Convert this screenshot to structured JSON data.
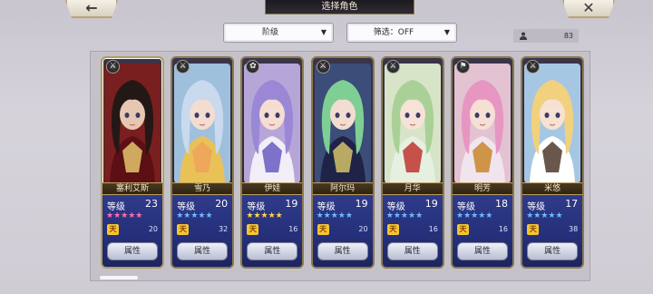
{
  "header": {
    "title": "选择角色",
    "back_icon": "←",
    "close_icon": "✕"
  },
  "filters": {
    "grade": {
      "label": "阶级",
      "arrow": "▼"
    },
    "filter": {
      "label": "筛选：OFF",
      "arrow": "▼"
    }
  },
  "roster_count": "83",
  "attr_label": "属性",
  "level_label": "等级",
  "characters": [
    {
      "name": "塞利艾斯",
      "level": "23",
      "stars_color": "#ff6fa8",
      "elem": "⚔",
      "sub_icon": "天",
      "sub_value": "20",
      "palette": {
        "bg": "#7a1f1f",
        "hair": "#241817",
        "skin": "#e7c7b1",
        "cloth": "#5c0f14",
        "accent": "#e3c56b"
      }
    },
    {
      "name": "雪乃",
      "level": "20",
      "stars_color": "#6fb8ff",
      "elem": "⚔",
      "sub_icon": "天",
      "sub_value": "32",
      "palette": {
        "bg": "#9fc0dc",
        "hair": "#c9d9ee",
        "skin": "#f3dcd0",
        "cloth": "#e8c256",
        "accent": "#f0a25a"
      }
    },
    {
      "name": "伊娃",
      "level": "19",
      "stars_color": "#ffd34a",
      "elem": "✿",
      "sub_icon": "天",
      "sub_value": "16",
      "palette": {
        "bg": "#b6a6d8",
        "hair": "#9a88d6",
        "skin": "#f5ddd2",
        "cloth": "#f1eef8",
        "accent": "#6a5ac2"
      }
    },
    {
      "name": "阿尔玛",
      "level": "19",
      "stars_color": "#6fb8ff",
      "elem": "⚔",
      "sub_icon": "天",
      "sub_value": "20",
      "palette": {
        "bg": "#3b4d78",
        "hair": "#7fcf94",
        "skin": "#f3dcd0",
        "cloth": "#1e2347",
        "accent": "#d3c26a"
      }
    },
    {
      "name": "月华",
      "level": "19",
      "stars_color": "#6fb8ff",
      "elem": "⚔",
      "sub_icon": "天",
      "sub_value": "16",
      "palette": {
        "bg": "#d7e4c8",
        "hair": "#a9d197",
        "skin": "#f6e2d6",
        "cloth": "#e6f0e0",
        "accent": "#c0342f"
      }
    },
    {
      "name": "明芳",
      "level": "18",
      "stars_color": "#6fb8ff",
      "elem": "⚑",
      "sub_icon": "天",
      "sub_value": "16",
      "palette": {
        "bg": "#e3c2d2",
        "hair": "#e796c2",
        "skin": "#f6dfd4",
        "cloth": "#f0e5ee",
        "accent": "#c8862a"
      }
    },
    {
      "name": "米悠",
      "level": "17",
      "stars_color": "#6fb8ff",
      "elem": "⚔",
      "sub_icon": "天",
      "sub_value": "38",
      "palette": {
        "bg": "#a6c7e4",
        "hair": "#f1d17e",
        "skin": "#f7e1d2",
        "cloth": "#ffffff",
        "accent": "#4d3a2a"
      }
    }
  ]
}
